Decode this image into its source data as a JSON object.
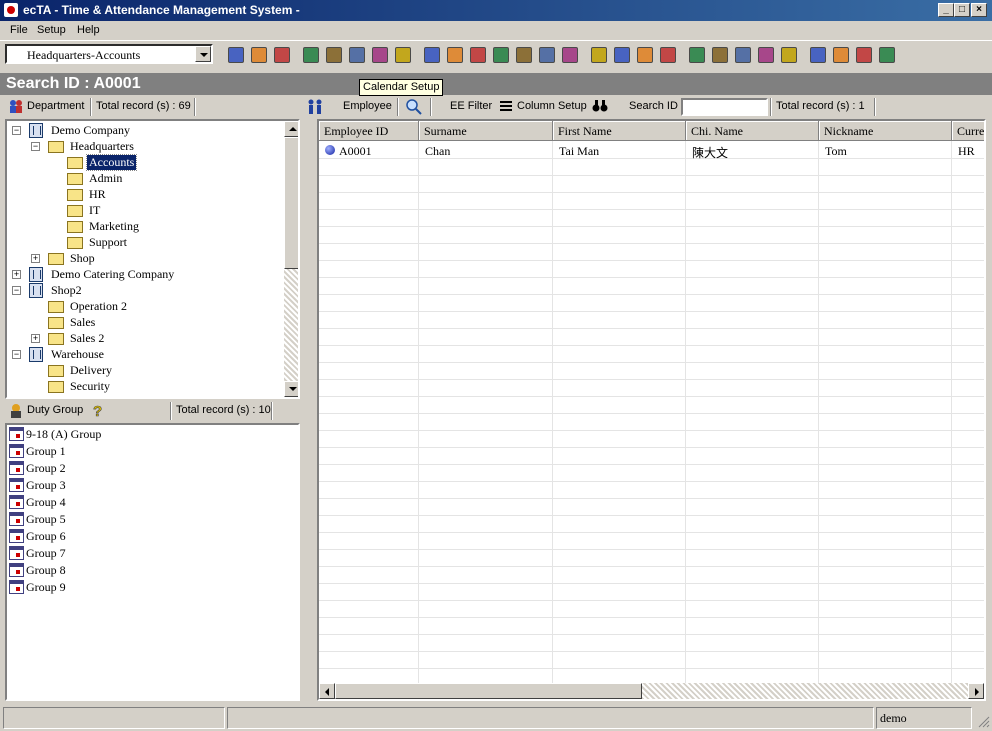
{
  "window": {
    "title": "ecTA - Time & Attendance Management System -",
    "controls": [
      "_",
      "□",
      "×"
    ]
  },
  "menu": [
    "File",
    "Setup",
    "Help"
  ],
  "toolbar": {
    "department_select": "Headquarters-Accounts",
    "icons": [
      "users-icon",
      "employee-icon",
      "card-icon",
      "book-icon",
      "report-icon",
      "roster-icon",
      "settings-icon",
      "clock-icon",
      "export-icon",
      "mail-icon",
      "money-icon",
      "run-icon",
      "chart-icon",
      "award-icon",
      "globe-icon",
      "printer-icon",
      "monitor-icon",
      "transfer-icon",
      "org-icon",
      "tools-icon",
      "document-icon",
      "level-icon",
      "tree-icon",
      "list-icon",
      "grid-icon",
      "help-icon",
      "key-icon",
      "exit-icon"
    ]
  },
  "search": {
    "label": "Search ID : A0001",
    "tooltip": "Calendar Setup"
  },
  "department_panel": {
    "label": "Department",
    "total": "Total record (s) : 69",
    "tree": [
      {
        "label": "Demo Company",
        "level": 0,
        "type": "building",
        "exp": "−"
      },
      {
        "label": "Headquarters",
        "level": 1,
        "type": "folder",
        "exp": "−"
      },
      {
        "label": "Accounts",
        "level": 2,
        "type": "folder",
        "selected": true
      },
      {
        "label": "Admin",
        "level": 2,
        "type": "folder"
      },
      {
        "label": "HR",
        "level": 2,
        "type": "folder"
      },
      {
        "label": "IT",
        "level": 2,
        "type": "folder"
      },
      {
        "label": "Marketing",
        "level": 2,
        "type": "folder"
      },
      {
        "label": "Support",
        "level": 2,
        "type": "folder"
      },
      {
        "label": "Shop",
        "level": 1,
        "type": "folder",
        "exp": "+"
      },
      {
        "label": "Demo Catering Company",
        "level": 0,
        "type": "building",
        "exp": "+"
      },
      {
        "label": "Shop2",
        "level": 0,
        "type": "building",
        "exp": "−"
      },
      {
        "label": "Operation 2",
        "level": 1,
        "type": "folder"
      },
      {
        "label": "Sales",
        "level": 1,
        "type": "folder"
      },
      {
        "label": "Sales 2",
        "level": 1,
        "type": "folder",
        "exp": "+"
      },
      {
        "label": "Warehouse",
        "level": 0,
        "type": "building",
        "exp": "−"
      },
      {
        "label": "Delivery",
        "level": 1,
        "type": "folder"
      },
      {
        "label": "Security",
        "level": 1,
        "type": "folder"
      }
    ]
  },
  "duty_panel": {
    "label": "Duty Group",
    "total": "Total record (s) : 10",
    "groups": [
      "9-18 (A) Group",
      "Group 1",
      "Group 2",
      "Group 3",
      "Group 4",
      "Group 5",
      "Group 6",
      "Group 7",
      "Group 8",
      "Group 9"
    ]
  },
  "employee_panel": {
    "label": "Employee",
    "filter": "EE Filter",
    "column_setup": "Column Setup",
    "search_label": "Search ID",
    "search_value": "",
    "total": "Total record (s) : 1",
    "columns": [
      "Employee ID",
      "Surname",
      "First Name",
      "Chi. Name",
      "Nickname",
      "Curre"
    ],
    "rows": [
      [
        "A0001",
        "Chan",
        "Tai Man",
        "陳大文",
        "Tom",
        "HR"
      ]
    ]
  },
  "status": {
    "user": "demo"
  }
}
